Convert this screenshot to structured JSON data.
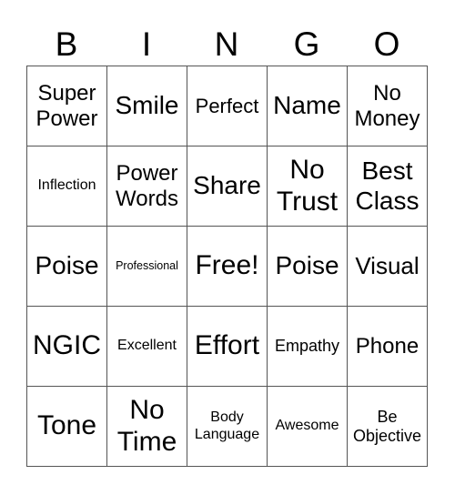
{
  "header": [
    "B",
    "I",
    "N",
    "G",
    "O"
  ],
  "cells": [
    "Super Power",
    "Smile",
    "Perfect",
    "Name",
    "No Money",
    "Inflection",
    "Power Words",
    "Share",
    "No Trust",
    "Best Class",
    "Poise",
    "Professional",
    "Free!",
    "Poise",
    "Visual",
    "NGIC",
    "Excellent",
    "Effort",
    "Empathy",
    "Phone",
    "Tone",
    "No Time",
    "Body Language",
    "Awesome",
    "Be Objective"
  ]
}
